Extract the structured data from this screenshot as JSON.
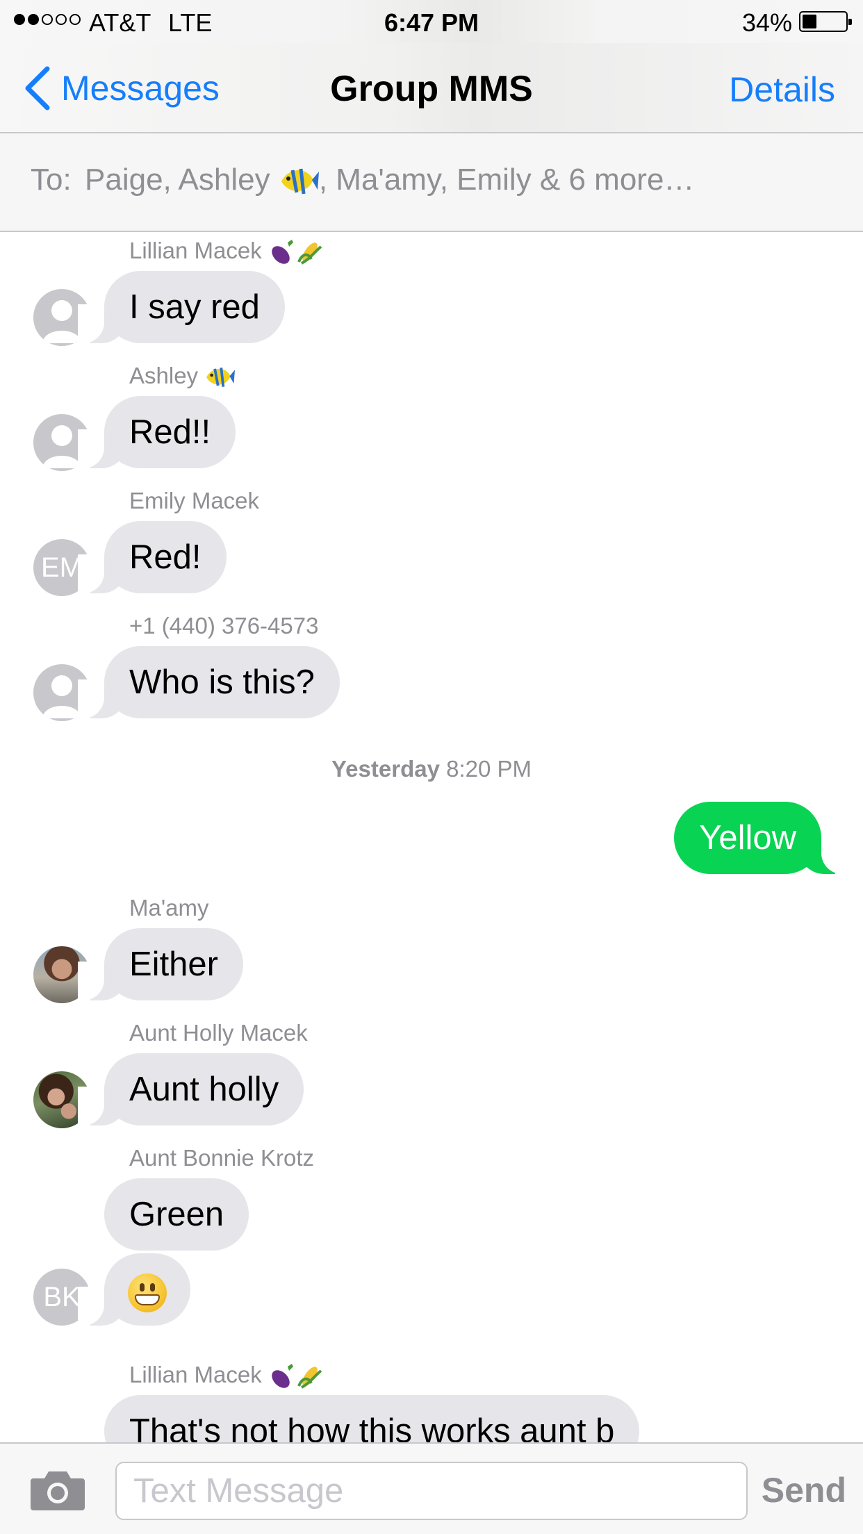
{
  "status_bar": {
    "carrier": "AT&T",
    "network": "LTE",
    "time": "6:47 PM",
    "battery_percent": "34%",
    "battery_level": 0.34,
    "signal_bars_filled": 2,
    "signal_bars_total": 5
  },
  "nav": {
    "back_label": "Messages",
    "title": "Group MMS",
    "details_label": "Details"
  },
  "to_bar": {
    "label": "To:",
    "recipients_before": "Paige, Ashley",
    "recipients_after": ", Ma'amy, Emily & 6 more…"
  },
  "messages": [
    {
      "sender": "Lillian Macek",
      "sender_icons": [
        "eggplant-emoji",
        "corn-emoji"
      ],
      "text": "I say red",
      "avatar": "silhouette"
    },
    {
      "sender": "Ashley",
      "sender_icons": [
        "tropical-fish-emoji"
      ],
      "text": "Red!!",
      "avatar": "silhouette"
    },
    {
      "sender": "Emily Macek",
      "text": "Red!",
      "avatar": "initials",
      "avatar_initials": "EM"
    },
    {
      "sender": "+1 (440) 376-4573",
      "text": "Who is this?",
      "avatar": "silhouette"
    },
    {
      "timestamp_day": "Yesterday",
      "timestamp_time": "8:20 PM"
    },
    {
      "outgoing": true,
      "text": "Yellow"
    },
    {
      "sender": "Ma'amy",
      "text": "Either",
      "avatar": "photo"
    },
    {
      "sender": "Aunt Holly Macek",
      "text": "Aunt holly",
      "avatar": "photo"
    },
    {
      "sender": "Aunt Bonnie Krotz",
      "text": "Green",
      "avatar": "initials",
      "avatar_initials": "BK"
    },
    {
      "sender": "Aunt Bonnie Krotz",
      "emoji": "grinning-face-emoji"
    },
    {
      "sender": "Lillian Macek",
      "sender_icons": [
        "eggplant-emoji",
        "corn-emoji"
      ],
      "text": "That's not how this works aunt b"
    }
  ],
  "input": {
    "placeholder": "Text Message",
    "send_label": "Send"
  },
  "colors": {
    "accent": "#157efb",
    "incoming_bubble": "#e5e5ea",
    "outgoing_bubble": "#09d352",
    "secondary_text": "#8e8e93"
  }
}
